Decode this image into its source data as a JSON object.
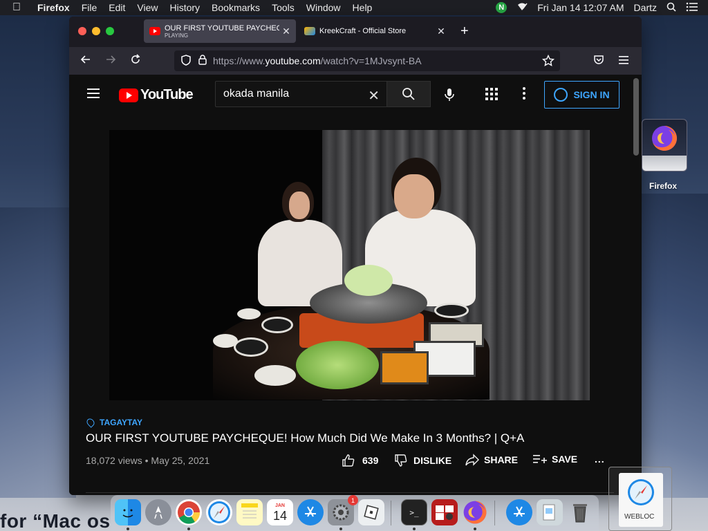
{
  "menubar": {
    "apple_icon": "apple-icon",
    "app": "Firefox",
    "items": [
      "File",
      "Edit",
      "View",
      "History",
      "Bookmarks",
      "Tools",
      "Window",
      "Help"
    ],
    "status_badge": "N",
    "datetime": "Fri Jan 14  12:07 AM",
    "user": "Dartz"
  },
  "browser": {
    "tabs": [
      {
        "title": "OUR FIRST YOUTUBE PAYCHEQUE! How Much Did We Make In 3 Months? | Q+A",
        "subtitle": "PLAYING",
        "active": true
      },
      {
        "title": "KreekCraft - Official Store",
        "subtitle": "",
        "active": false
      }
    ],
    "url_prefix": "https://www.",
    "url_domain": "youtube.com",
    "url_suffix": "/watch?v=1MJvsynt-BA"
  },
  "youtube": {
    "logo_text": "YouTube",
    "search_value": "okada manila",
    "sign_in_label": "SIGN IN",
    "video": {
      "location": "TAGAYTAY",
      "title": "OUR FIRST YOUTUBE PAYCHEQUE! How Much Did We Make In 3 Months? | Q+A",
      "views": "18,072 views",
      "date": "May 25, 2021",
      "likes": "639",
      "dislike_label": "DISLIKE",
      "share_label": "SHARE",
      "save_label": "SAVE",
      "more_label": "..."
    }
  },
  "desktop": {
    "firefox_label": "Firefox",
    "webloc_label": "WEBLOC",
    "bottom_text": "for “Mac os"
  },
  "dock": {
    "items": [
      "Finder",
      "Launchpad",
      "Chrome",
      "Safari",
      "Notes",
      "Calendar",
      "App Store",
      "System Preferences",
      "Roblox",
      "Terminal",
      "Photo Booth",
      "Firefox",
      "App Store",
      "Preview",
      "Trash"
    ],
    "calendar_month": "JAN",
    "calendar_day": "14",
    "sysprefs_badge": "1"
  },
  "colors": {
    "youtube_red": "#ff0000",
    "link_blue": "#3ea6ff",
    "window_bg": "#0f0f0f"
  }
}
